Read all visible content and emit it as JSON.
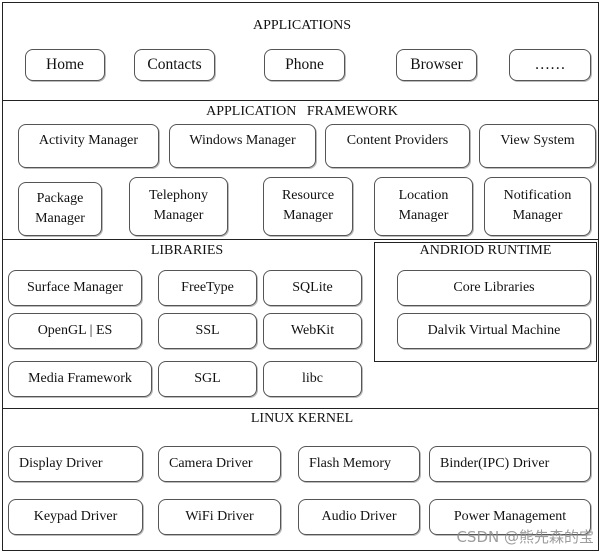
{
  "applications": {
    "title": "APPLICATIONS",
    "items": [
      "Home",
      "Contacts",
      "Phone",
      "Browser",
      "……"
    ]
  },
  "framework": {
    "title": "APPLICATION   FRAMEWORK",
    "row1": [
      "Activity Manager",
      "Windows Manager",
      "Content Providers",
      "View System"
    ],
    "row2": [
      {
        "line1": "Package",
        "line2": "Manager"
      },
      {
        "line1": "Telephony",
        "line2": "Manager"
      },
      {
        "line1": "Resource",
        "line2": "Manager"
      },
      {
        "line1": "Location",
        "line2": "Manager"
      },
      {
        "line1": "Notification",
        "line2": "Manager"
      }
    ]
  },
  "libraries": {
    "title": "LIBRARIES",
    "items": [
      "Surface Manager",
      "FreeType",
      "SQLite",
      "OpenGL | ES",
      "SSL",
      "WebKit",
      "Media Framework",
      "SGL",
      "libc"
    ]
  },
  "runtime": {
    "title": "ANDRIOD RUNTIME",
    "items": [
      "Core Libraries",
      "Dalvik Virtual Machine"
    ]
  },
  "kernel": {
    "title": "LINUX KERNEL",
    "items": [
      "Display Driver",
      "Camera Driver",
      "Flash Memory",
      "Binder(IPC) Driver",
      "Keypad Driver",
      "WiFi Driver",
      "Audio Driver",
      "Power Management"
    ]
  },
  "watermark": "CSDN @熊先森的宝"
}
